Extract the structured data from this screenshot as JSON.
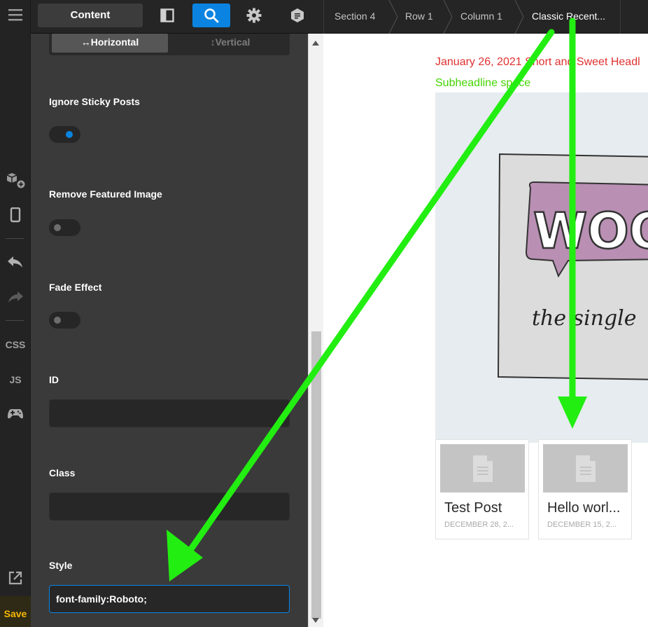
{
  "topbar": {
    "content_tab": "Content",
    "breadcrumbs": [
      "Section 4",
      "Row 1",
      "Column 1",
      "Classic Recent..."
    ]
  },
  "rail": {
    "css_label": "CSS",
    "js_label": "JS",
    "save_label": "Save"
  },
  "panel": {
    "orientation_horizontal": "↔Horizontal",
    "orientation_vertical": "↕Vertical",
    "ignore_sticky_label": "Ignore Sticky Posts",
    "ignore_sticky_on": true,
    "remove_featured_label": "Remove Featured Image",
    "remove_featured_on": false,
    "fade_effect_label": "Fade Effect",
    "fade_effect_on": false,
    "id_label": "ID",
    "id_value": "",
    "class_label": "Class",
    "class_value": "",
    "style_label": "Style",
    "style_value": "font-family:Roboto;"
  },
  "preview": {
    "headline": "January 26, 2021 Short and Sweet Headl",
    "subheadline": "Subheadline space",
    "feature_logo_text": "WOO",
    "feature_caption": "the single",
    "posts": [
      {
        "title": "Test Post",
        "date": "DECEMBER 28, 2..."
      },
      {
        "title": "Hello worl...",
        "date": "DECEMBER 15, 2..."
      }
    ]
  },
  "colors": {
    "accent": "#0a84e0",
    "save": "#f5b800",
    "headline": "#e03030",
    "subheadline": "#44d400",
    "annotation_arrow": "#22ee11"
  },
  "icons": [
    "menu-icon",
    "layout-icon",
    "search-icon",
    "gear-icon",
    "wordpress-icon",
    "add-element-icon",
    "mobile-icon",
    "undo-icon",
    "redo-icon",
    "gamepad-icon",
    "external-link-icon",
    "document-icon"
  ]
}
